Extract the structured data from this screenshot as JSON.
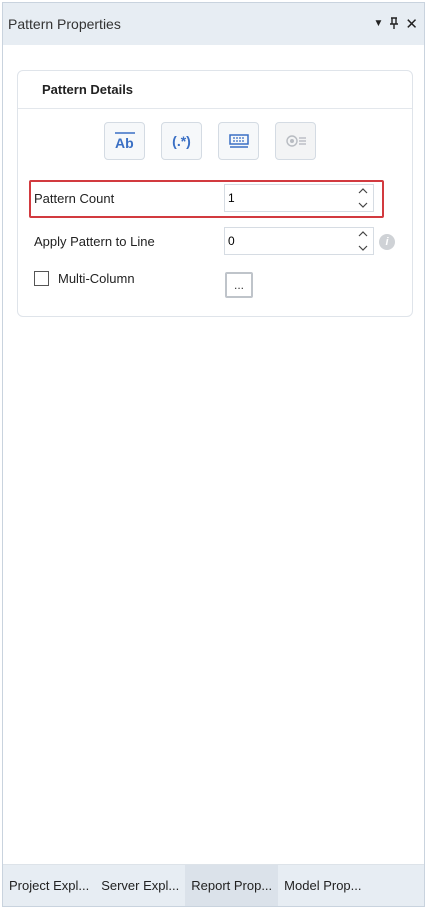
{
  "window": {
    "title": "Pattern Properties",
    "actions": {
      "dropdown_icon": "▼",
      "pin_icon": "ꟸ",
      "close_icon": "✕"
    }
  },
  "card": {
    "title": "Pattern Details",
    "toolbar": [
      {
        "icon": "text-ab-icon",
        "enabled": true
      },
      {
        "icon": "regex-icon",
        "label": "(.*)",
        "enabled": true
      },
      {
        "icon": "keyboard-icon",
        "enabled": true
      },
      {
        "icon": "settings-list-icon",
        "enabled": false
      }
    ],
    "pattern_count": {
      "label": "Pattern Count",
      "value": "1"
    },
    "apply_pattern": {
      "label": "Apply Pattern to Line",
      "value": "0",
      "info_icon": "i"
    },
    "multi_column": {
      "label": "Multi-Column",
      "checked": false,
      "button_label": "..."
    }
  },
  "tabs": [
    {
      "label": "Project Expl...",
      "active": false
    },
    {
      "label": "Server Expl...",
      "active": false
    },
    {
      "label": "Report Prop...",
      "active": true
    },
    {
      "label": "Model Prop...",
      "active": false
    }
  ],
  "colors": {
    "accent_blue": "#3a6fc4",
    "highlight_red": "#d23a3f",
    "title_bg": "#e7edf3"
  }
}
